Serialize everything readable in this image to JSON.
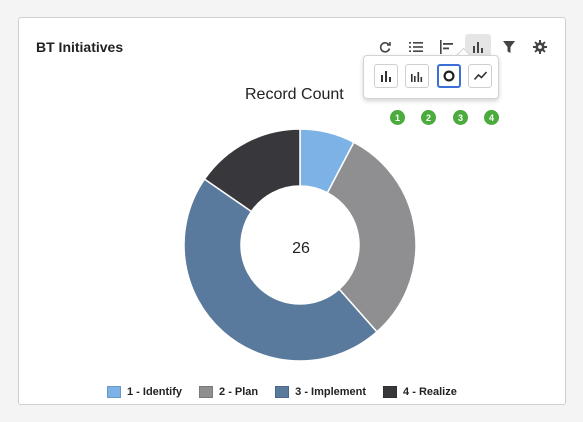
{
  "card": {
    "title": "BT Initiatives"
  },
  "toolbar": {
    "icons": [
      "refresh-icon",
      "list-icon",
      "horizontal-bar-icon",
      "bar-chart-icon",
      "filter-icon",
      "gear-icon"
    ],
    "active": "bar-chart-icon"
  },
  "chart_type_menu": {
    "options": [
      {
        "icon": "bar-chart-icon",
        "badge": "1"
      },
      {
        "icon": "grouped-bar-icon",
        "badge": "2"
      },
      {
        "icon": "donut-icon",
        "badge": "3",
        "selected": true
      },
      {
        "icon": "line-chart-icon",
        "badge": "4"
      }
    ],
    "badge_color": "#4bab3d",
    "selected_border_color": "#3c6fd6"
  },
  "chart_data": {
    "type": "pie",
    "title": "Record Count",
    "center_label": "26",
    "categories": [
      "1 - Identify",
      "2 - Plan",
      "3 - Implement",
      "4 - Realize"
    ],
    "values": [
      2,
      8,
      12,
      4
    ],
    "colors": [
      "#7cb2e6",
      "#8f8f91",
      "#5a7a9d",
      "#38383c"
    ],
    "legend_position": "bottom"
  }
}
